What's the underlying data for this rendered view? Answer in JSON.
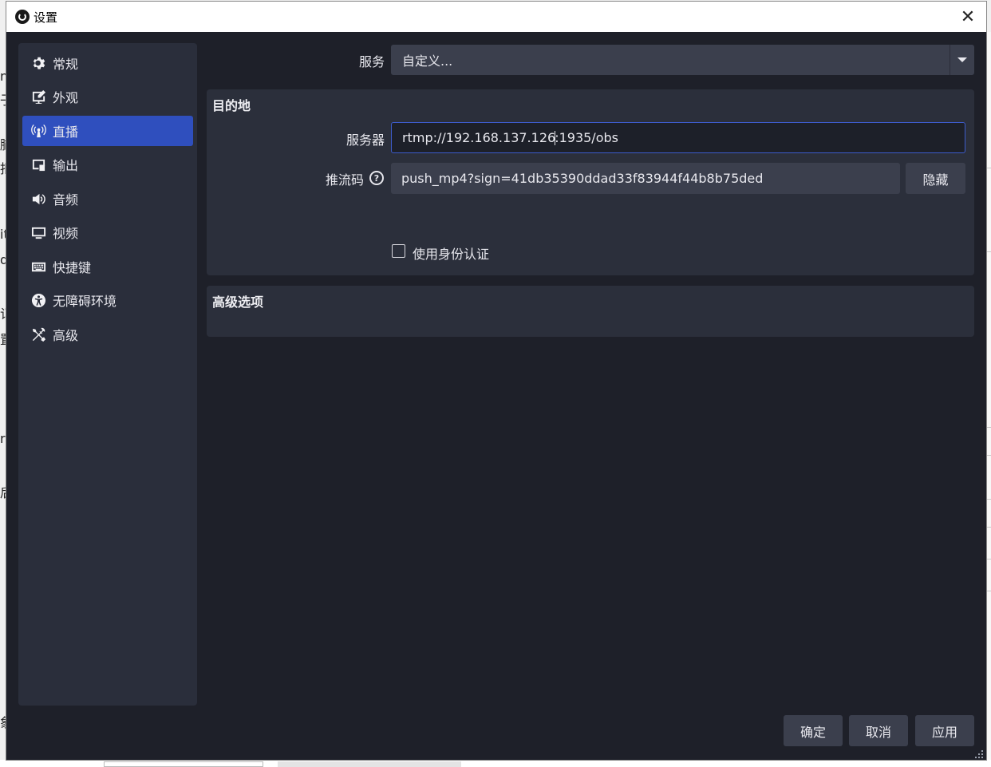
{
  "window": {
    "title": "设置",
    "close_glyph": "✕"
  },
  "sidebar": {
    "items": [
      {
        "label": "常规",
        "icon": "gear-icon"
      },
      {
        "label": "外观",
        "icon": "appearance-icon"
      },
      {
        "label": "直播",
        "icon": "antenna-icon",
        "active": true
      },
      {
        "label": "输出",
        "icon": "output-icon"
      },
      {
        "label": "音频",
        "icon": "speaker-icon"
      },
      {
        "label": "视频",
        "icon": "monitor-icon"
      },
      {
        "label": "快捷键",
        "icon": "keyboard-icon"
      },
      {
        "label": "无障碍环境",
        "icon": "accessibility-icon"
      },
      {
        "label": "高级",
        "icon": "tools-icon"
      }
    ]
  },
  "stream": {
    "service_label": "服务",
    "service_value": "自定义...",
    "destination": {
      "title": "目的地",
      "server_label": "服务器",
      "server_value_before_caret": "rtmp://192.168.137.126",
      "server_value_after_caret": ":1935/obs",
      "key_label": "推流码",
      "key_value": "push_mp4?sign=41db35390ddad33f83944f44b8b75ded",
      "hide_button": "隐藏",
      "auth_checkbox_label": "使用身份认证",
      "auth_checked": false
    },
    "advanced": {
      "title": "高级选项"
    }
  },
  "footer": {
    "ok": "确定",
    "cancel": "取消",
    "apply": "应用"
  },
  "theme": {
    "window_bg": "#1e2029",
    "panel_bg": "#2b2f3b",
    "input_bg": "#3b3f4d",
    "accent": "#2f4fbe"
  }
}
